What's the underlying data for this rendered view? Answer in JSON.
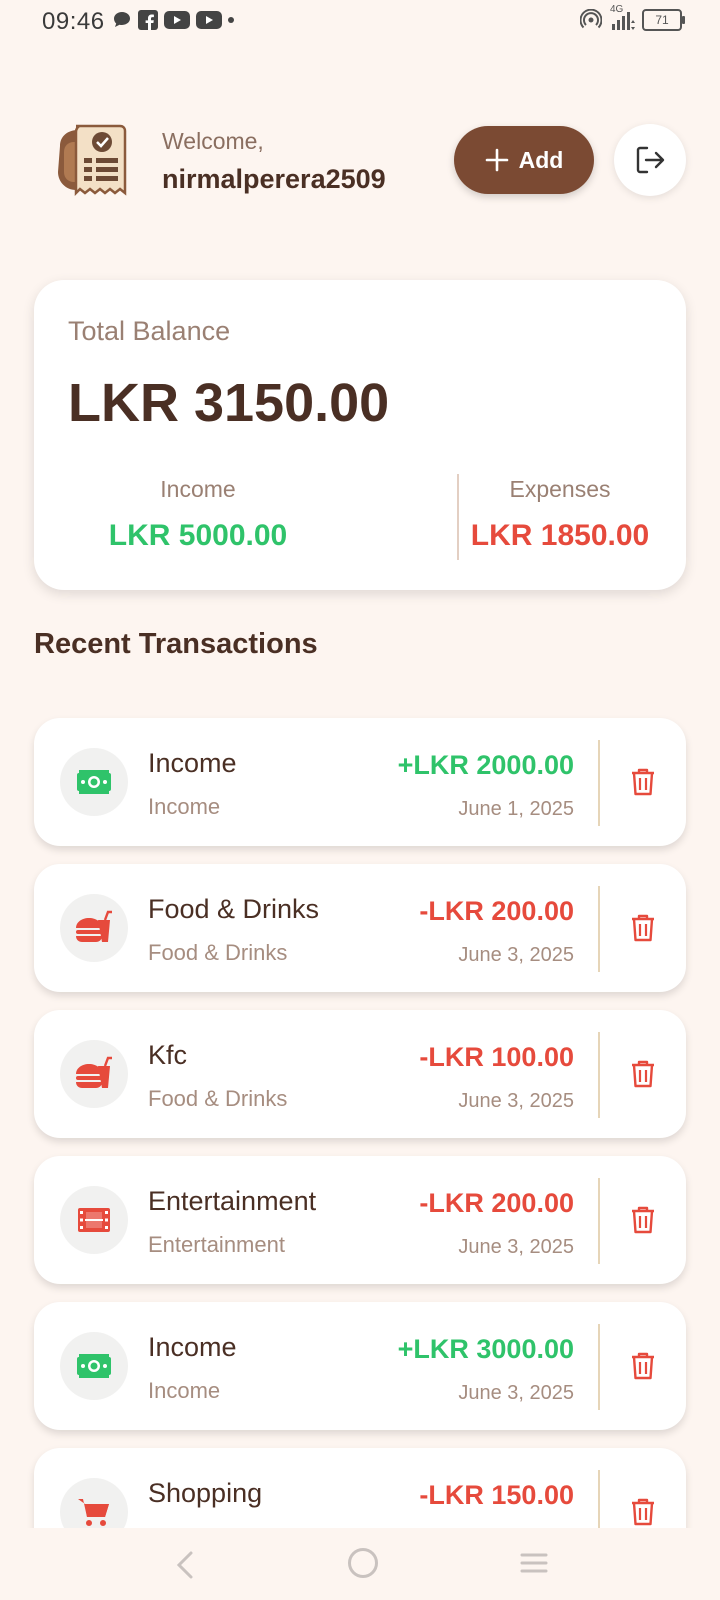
{
  "status_bar": {
    "time": "09:46",
    "network": "4G",
    "battery": "71"
  },
  "header": {
    "welcome_label": "Welcome,",
    "username": "nirmalperera2509",
    "add_label": "Add",
    "logout_icon": "logout-icon",
    "logo_icon": "receipt-logo-icon"
  },
  "balance": {
    "label": "Total Balance",
    "amount": "LKR 3150.00",
    "income_label": "Income",
    "income_value": "LKR 5000.00",
    "expenses_label": "Expenses",
    "expenses_value": "LKR 1850.00"
  },
  "section_title": "Recent Transactions",
  "transactions": [
    {
      "title": "Income",
      "category": "Income",
      "amount": "+LKR 2000.00",
      "date": "June 1, 2025",
      "type": "income",
      "icon": "money-icon"
    },
    {
      "title": "Food & Drinks",
      "category": "Food & Drinks",
      "amount": "-LKR 200.00",
      "date": "June 3, 2025",
      "type": "expense",
      "icon": "fastfood-icon"
    },
    {
      "title": "Kfc",
      "category": "Food & Drinks",
      "amount": "-LKR 100.00",
      "date": "June 3, 2025",
      "type": "expense",
      "icon": "fastfood-icon"
    },
    {
      "title": "Entertainment",
      "category": "Entertainment",
      "amount": "-LKR 200.00",
      "date": "June 3, 2025",
      "type": "expense",
      "icon": "film-icon"
    },
    {
      "title": "Income",
      "category": "Income",
      "amount": "+LKR 3000.00",
      "date": "June 3, 2025",
      "type": "income",
      "icon": "money-icon"
    },
    {
      "title": "Shopping",
      "category": "",
      "amount": "-LKR 150.00",
      "date": "",
      "type": "expense",
      "icon": "cart-icon"
    }
  ],
  "colors": {
    "background": "#fdf5f0",
    "brand_brown": "#7b4a33",
    "income_green": "#2fc36a",
    "expense_red": "#e64a3c",
    "text_dark": "#4a2f24"
  }
}
